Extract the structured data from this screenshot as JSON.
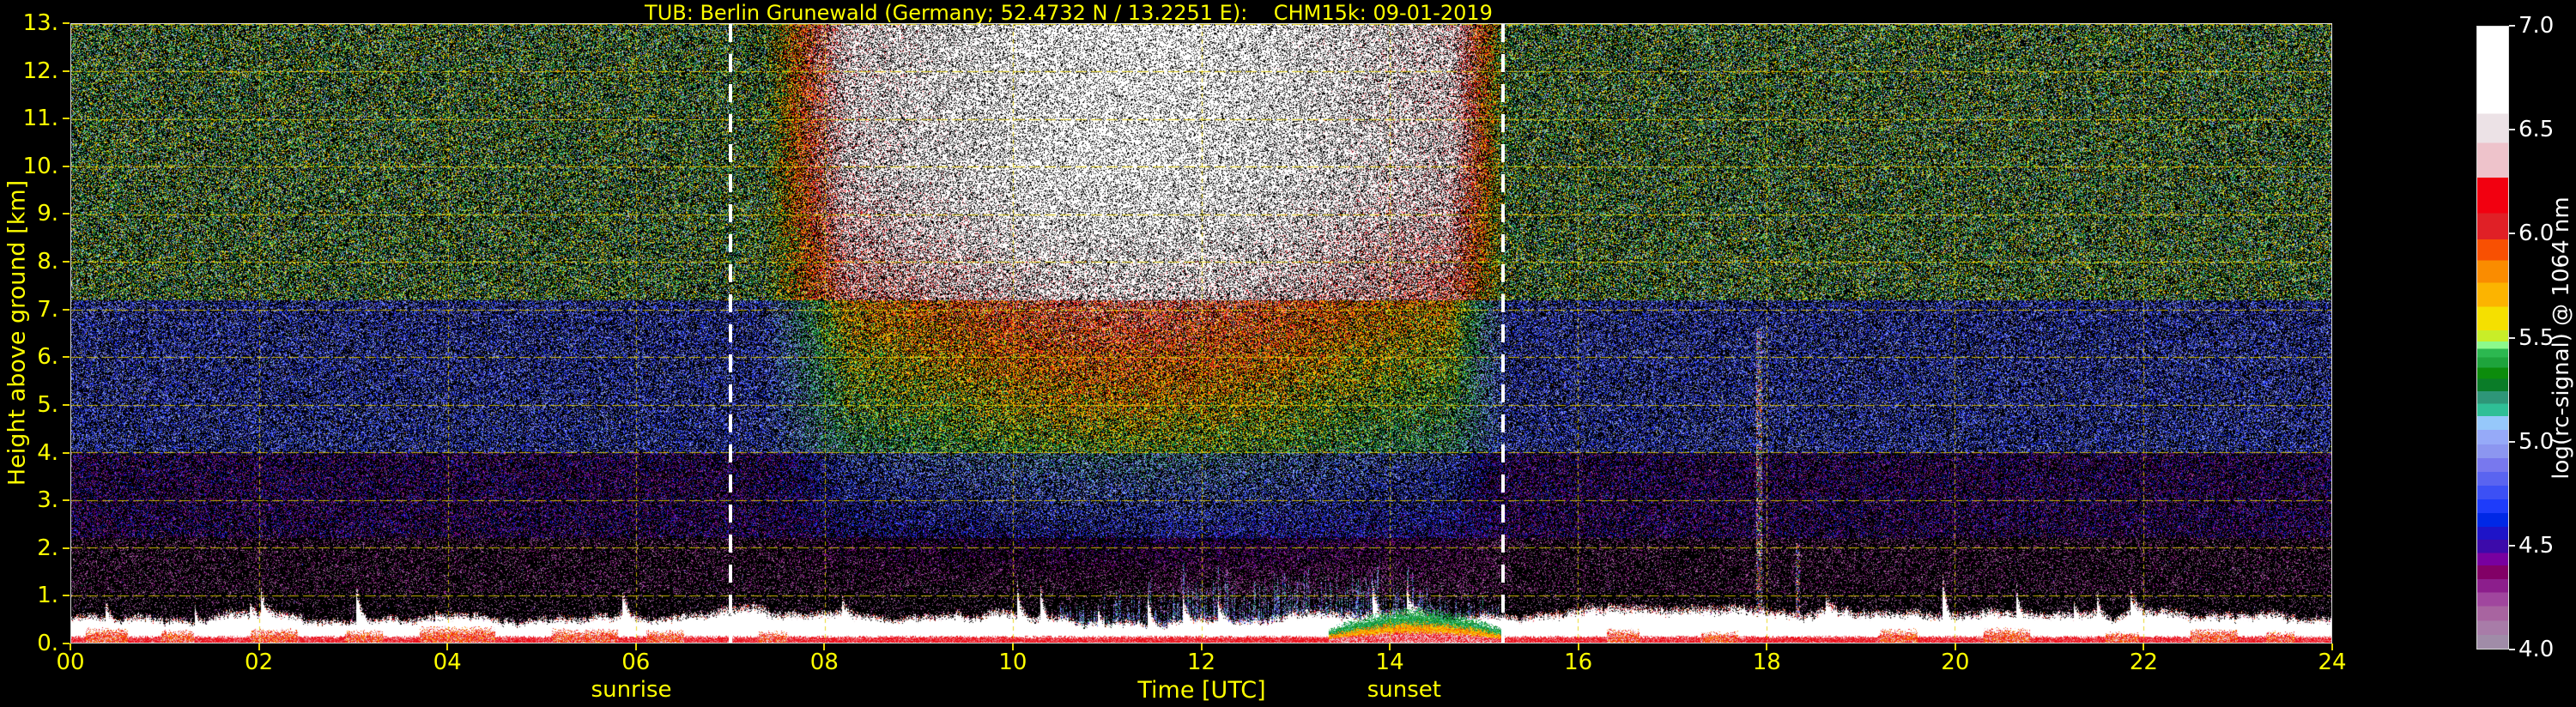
{
  "chart_data": {
    "type": "heatmap",
    "title": "TUB: Berlin Grunewald (Germany; 52.4732 N / 13.2251 E):    CHM15k: 09-01-2019",
    "station": "TUB: Berlin Grunewald",
    "country": "Germany",
    "coordinates": "52.4732 N / 13.2251 E",
    "instrument": "CHM15k",
    "date": "09-01-2019",
    "xlabel": "Time [UTC]",
    "ylabel": "Height above ground [km]",
    "colorbar_label": "log(rc-signal) @ 1064 nm",
    "x_range_hours": [
      0,
      24
    ],
    "y_range_km": [
      0,
      13
    ],
    "x_ticks": [
      "00",
      "02",
      "04",
      "06",
      "08",
      "10",
      "12",
      "14",
      "16",
      "18",
      "20",
      "22",
      "24"
    ],
    "x_tick_hours": [
      0,
      2,
      4,
      6,
      8,
      10,
      12,
      14,
      16,
      18,
      20,
      22,
      24
    ],
    "y_ticks": [
      "13.",
      "12.",
      "11.",
      "10.",
      "9.",
      "8.",
      "7.",
      "6.",
      "5.",
      "4.",
      "3.",
      "2.",
      "1.",
      "0."
    ],
    "y_tick_km": [
      13,
      12,
      11,
      10,
      9,
      8,
      7,
      6,
      5,
      4,
      3,
      2,
      1,
      0
    ],
    "colorbar_range": [
      4.0,
      7.0
    ],
    "colorbar_ticks": [
      "7.0",
      "6.5",
      "6.0",
      "5.5",
      "5.0",
      "4.5",
      "4.0"
    ],
    "colorbar_tick_values": [
      7.0,
      6.5,
      6.0,
      5.5,
      5.0,
      4.5,
      4.0
    ],
    "grid": {
      "horizontal": "dashed yellow line every 1 km",
      "vertical": "dotted yellow line every 2 h"
    },
    "annotations": {
      "sunrise": {
        "label": "sunrise",
        "hour": 7.0
      },
      "sunset": {
        "label": "sunset",
        "hour": 15.2
      }
    },
    "colormap_stops": [
      [
        0.0,
        "#a08ca8"
      ],
      [
        0.022,
        "#a87ca8"
      ],
      [
        0.045,
        "#a864a0"
      ],
      [
        0.068,
        "#a0469e"
      ],
      [
        0.09,
        "#8c1e8c"
      ],
      [
        0.112,
        "#820066"
      ],
      [
        0.134,
        "#7800a0"
      ],
      [
        0.154,
        "#3c0aaa"
      ],
      [
        0.175,
        "#1e14c8"
      ],
      [
        0.196,
        "#0028e6"
      ],
      [
        0.218,
        "#1e3cfa"
      ],
      [
        0.24,
        "#3c50f5"
      ],
      [
        0.262,
        "#5a64f0"
      ],
      [
        0.284,
        "#7878ee"
      ],
      [
        0.306,
        "#8c96f0"
      ],
      [
        0.328,
        "#96aaf8"
      ],
      [
        0.352,
        "#96c8fa"
      ],
      [
        0.374,
        "#2fbf96"
      ],
      [
        0.394,
        "#2e9678"
      ],
      [
        0.414,
        "#0a7c28"
      ],
      [
        0.434,
        "#0c8c0c"
      ],
      [
        0.452,
        "#1ea43c"
      ],
      [
        0.468,
        "#2cb850"
      ],
      [
        0.482,
        "#8cfa8c"
      ],
      [
        0.494,
        "#c8ee28"
      ],
      [
        0.512,
        "#f5e000"
      ],
      [
        0.55,
        "#fcb400"
      ],
      [
        0.588,
        "#fa8c00"
      ],
      [
        0.624,
        "#f85002"
      ],
      [
        0.658,
        "#e02026"
      ],
      [
        0.7,
        "#f20010"
      ],
      [
        0.757,
        "#eec3cb"
      ],
      [
        0.813,
        "#ece2e6"
      ],
      [
        0.86,
        "#ffffff"
      ],
      [
        1.0,
        "#ffffff"
      ]
    ],
    "field_model": {
      "description": "speckled lidar noise field: green speckle aloft / blue mid-levels / purple-dark low levels at night; bright warm (orange-pink-white) solar background aloft between sunrise and sunset; persistent white aerosol layer below ~1 km with red near-surface signal; blue haze streaks above the boundary layer around midday; multicoloured surface bloom 13:20-15:15; thin colourful precipitation streaks near 18:00",
      "day": {
        "start": 7.35,
        "ramp_in": 0.9,
        "end": 15.25,
        "ramp_out": 0.6,
        "peak": 11.3
      },
      "blue_haze": {
        "start": 10.5,
        "end": 15.15
      },
      "surface_bloom": {
        "start": 13.35,
        "end": 15.2
      },
      "surface_hotspots": [
        [
          0.15,
          0.6,
          0.26
        ],
        [
          0.95,
          1.3,
          0.22
        ],
        [
          1.9,
          2.4,
          0.24
        ],
        [
          2.9,
          3.3,
          0.22
        ],
        [
          3.7,
          4.5,
          0.28
        ],
        [
          5.1,
          5.8,
          0.24
        ],
        [
          6.1,
          6.5,
          0.22
        ],
        [
          7.3,
          7.6,
          0.2
        ],
        [
          16.3,
          16.65,
          0.24
        ],
        [
          17.3,
          17.7,
          0.2
        ],
        [
          19.2,
          19.6,
          0.24
        ],
        [
          20.3,
          20.8,
          0.26
        ],
        [
          21.6,
          21.95,
          0.2
        ],
        [
          22.5,
          23.0,
          0.24
        ],
        [
          23.3,
          23.6,
          0.2
        ]
      ],
      "streaks": [
        {
          "hour": 17.92,
          "half_width": 0.028,
          "top_km": 6.6
        },
        {
          "hour": 18.33,
          "half_width": 0.02,
          "top_km": 2.1
        }
      ]
    }
  },
  "colors": {
    "background": "#000000",
    "axis_text": "#ffff00",
    "colorbar_text": "#ffffff",
    "frame": "#d9d9d9",
    "grid": "#e6d000",
    "sun_line": "#ffffff"
  }
}
